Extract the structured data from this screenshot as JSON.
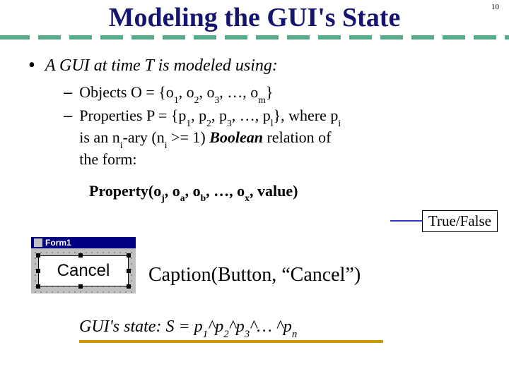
{
  "slide_number": "10",
  "title": "Modeling the GUI's State",
  "bullet": {
    "text": "A GUI at time T is modeled using:"
  },
  "dashes": [
    {
      "prefix": "Objects O = {o",
      "s1": "1",
      "mid1": ", o",
      "s2": "2",
      "mid2": ", o",
      "s3": "3",
      "mid3": ", …, o",
      "s4": "m",
      "end": "}"
    },
    {
      "prefix": "Properties P = {p",
      "s1": "1",
      "mid1": ", p",
      "s2": "2",
      "mid2": ", p",
      "s3": "3",
      "mid3": ", …, p",
      "s4": "l",
      "end": "}, where p",
      "s5": "i",
      "line2a": "is an n",
      "s6": "i",
      "line2b": "-ary (n",
      "s7": "i",
      "line2c": " >= 1) ",
      "bool": "Boolean",
      "line2d": " relation of",
      "line3": "the form:"
    }
  ],
  "property": {
    "label": "Property(o",
    "sj": "j",
    "m1": ", o",
    "sa": "a",
    "m2": ", o",
    "sb": "b",
    "m3": ", …, o",
    "sx": "x",
    "m4": ", value)"
  },
  "truefalse": "True/False",
  "form": {
    "title": "Form1",
    "button_label": "Cancel"
  },
  "caption_text": "Caption(Button, “Cancel”)",
  "state": {
    "pre": "GUI's state: S = p",
    "s1": "1",
    "c": "^p",
    "s2": "2",
    "s3": "3",
    "tail": "^… ^p",
    "sn": "n"
  }
}
